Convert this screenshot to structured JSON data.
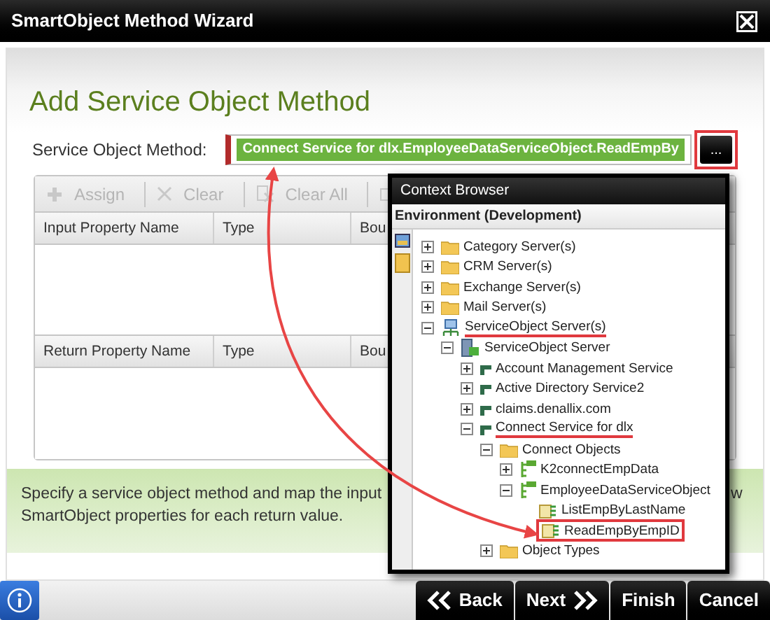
{
  "window": {
    "title": "SmartObject Method Wizard"
  },
  "heading": "Add Service Object Method",
  "method_field": {
    "label": "Service Object Method:",
    "value": "Connect Service for dlx.EmployeeDataServiceObject.ReadEmpBy"
  },
  "browse_button": {
    "label": "...",
    "marked": true
  },
  "toolbar": [
    {
      "label": "Assign",
      "kind": "plus",
      "disabled": true
    },
    {
      "label": "Clear",
      "kind": "cross",
      "disabled": true
    },
    {
      "label": "Clear All",
      "kind": "clear-all",
      "disabled": true
    }
  ],
  "input_table": {
    "columns": [
      "Input Property Name",
      "Type",
      "Bou"
    ]
  },
  "return_table": {
    "columns": [
      "Return Property Name",
      "Type",
      "Bou"
    ]
  },
  "hint": {
    "line_1": "Specify a service object method and map the input",
    "line_1_end": "w",
    "line_2": "SmartObject properties for each return value."
  },
  "context_browser": {
    "title": "Context Browser",
    "environment": "Environment (Development)",
    "tree": [
      {
        "label": "Category Server(s)",
        "kind": "folder",
        "expanded": false,
        "marked": false
      },
      {
        "label": "CRM Server(s)",
        "kind": "folder",
        "expanded": false,
        "marked": false
      },
      {
        "label": "Exchange Server(s)",
        "kind": "folder",
        "expanded": false,
        "marked": false
      },
      {
        "label": "Mail Server(s)",
        "kind": "folder",
        "expanded": false,
        "marked": false
      },
      {
        "label": "ServiceObject Server(s)",
        "kind": "network",
        "expanded": true,
        "marked": true,
        "children": [
          {
            "label": "ServiceObject Server",
            "kind": "server",
            "expanded": true,
            "marked": false,
            "children": [
              {
                "label": "Account Management Service",
                "kind": "service",
                "expanded": false,
                "marked": false
              },
              {
                "label": "Active Directory Service2",
                "kind": "service",
                "expanded": false,
                "marked": false
              },
              {
                "label": "claims.denallix.com",
                "kind": "service",
                "expanded": false,
                "marked": false
              },
              {
                "label": "Connect Service for dlx",
                "kind": "service",
                "expanded": true,
                "marked": true,
                "children": [
                  {
                    "label": "Connect Objects",
                    "kind": "folder",
                    "expanded": true,
                    "marked": false,
                    "children": [
                      {
                        "label": "K2connectEmpData",
                        "kind": "object",
                        "expanded": false,
                        "marked": false
                      },
                      {
                        "label": "EmployeeDataServiceObject",
                        "kind": "object",
                        "expanded": true,
                        "marked": false,
                        "children": [
                          {
                            "label": "ListEmpByLastName",
                            "kind": "method",
                            "marked": false
                          },
                          {
                            "label": "ReadEmpByEmpID",
                            "kind": "method",
                            "marked": true
                          }
                        ]
                      }
                    ]
                  },
                  {
                    "label": "Object Types",
                    "kind": "folder",
                    "expanded": false,
                    "marked": false
                  }
                ]
              }
            ]
          }
        ]
      }
    ]
  },
  "buttons": [
    {
      "label": "Back",
      "kind": "back"
    },
    {
      "label": "Next",
      "kind": "next"
    },
    {
      "label": "Finish",
      "kind": "plain"
    },
    {
      "label": "Cancel",
      "kind": "plain"
    }
  ]
}
